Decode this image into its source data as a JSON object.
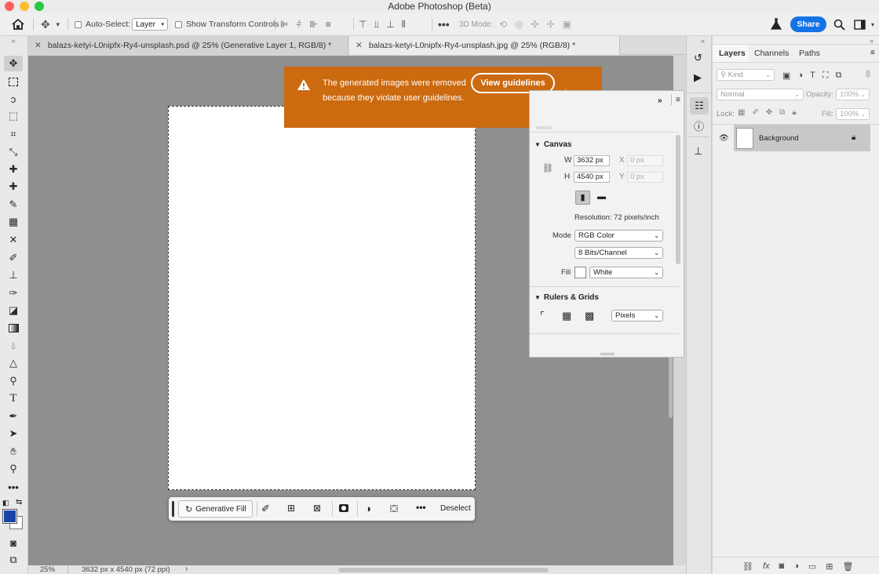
{
  "window": {
    "title": "Adobe Photoshop (Beta)"
  },
  "options_bar": {
    "auto_select_label": "Auto-Select:",
    "auto_select_value": "Layer",
    "show_transform_label": "Show Transform Controls",
    "mode_3d_label": "3D Mode:",
    "share_label": "Share"
  },
  "tabs": [
    {
      "label": "balazs-ketyi-L0nipfx-Ry4-unsplash.psd @ 25% (Generative Layer 1, RGB/8) *"
    },
    {
      "label": "balazs-ketyi-L0nipfx-Ry4-unsplash.jpg @ 25% (RGB/8) *"
    }
  ],
  "toast": {
    "message": "The generated images were removed because they violate user guidelines.",
    "button_label": "View guidelines"
  },
  "context_bar": {
    "generative_fill_label": "Generative Fill",
    "deselect_label": "Deselect"
  },
  "properties": {
    "canvas_header": "Canvas",
    "w_label": "W",
    "w_value": "3632 px",
    "h_label": "H",
    "h_value": "4540 px",
    "x_label": "X",
    "x_placeholder": "0 px",
    "y_label": "Y",
    "y_placeholder": "0 px",
    "resolution": "Resolution: 72 pixels/inch",
    "mode_label": "Mode",
    "mode_value": "RGB Color",
    "bits_value": "8 Bits/Channel",
    "fill_label": "Fill",
    "fill_value": "White",
    "rulers_header": "Rulers & Grids",
    "units_value": "Pixels"
  },
  "layers_panel": {
    "tabs": [
      "Layers",
      "Channels",
      "Paths"
    ],
    "kind_label": "Kind",
    "blend_mode": "Normal",
    "opacity_label": "Opacity:",
    "opacity_value": "100%",
    "lock_label": "Lock:",
    "fill_label": "Fill:",
    "fill_value": "100%",
    "layer_name": "Background"
  },
  "status": {
    "zoom": "25%",
    "doc_info": "3632 px x 4540 px (72 ppi)"
  },
  "colors": {
    "toast_bg": "#cb6a0f",
    "share_bg": "#1473e6",
    "foreground": "#1744a8",
    "background": "#ffffff"
  }
}
